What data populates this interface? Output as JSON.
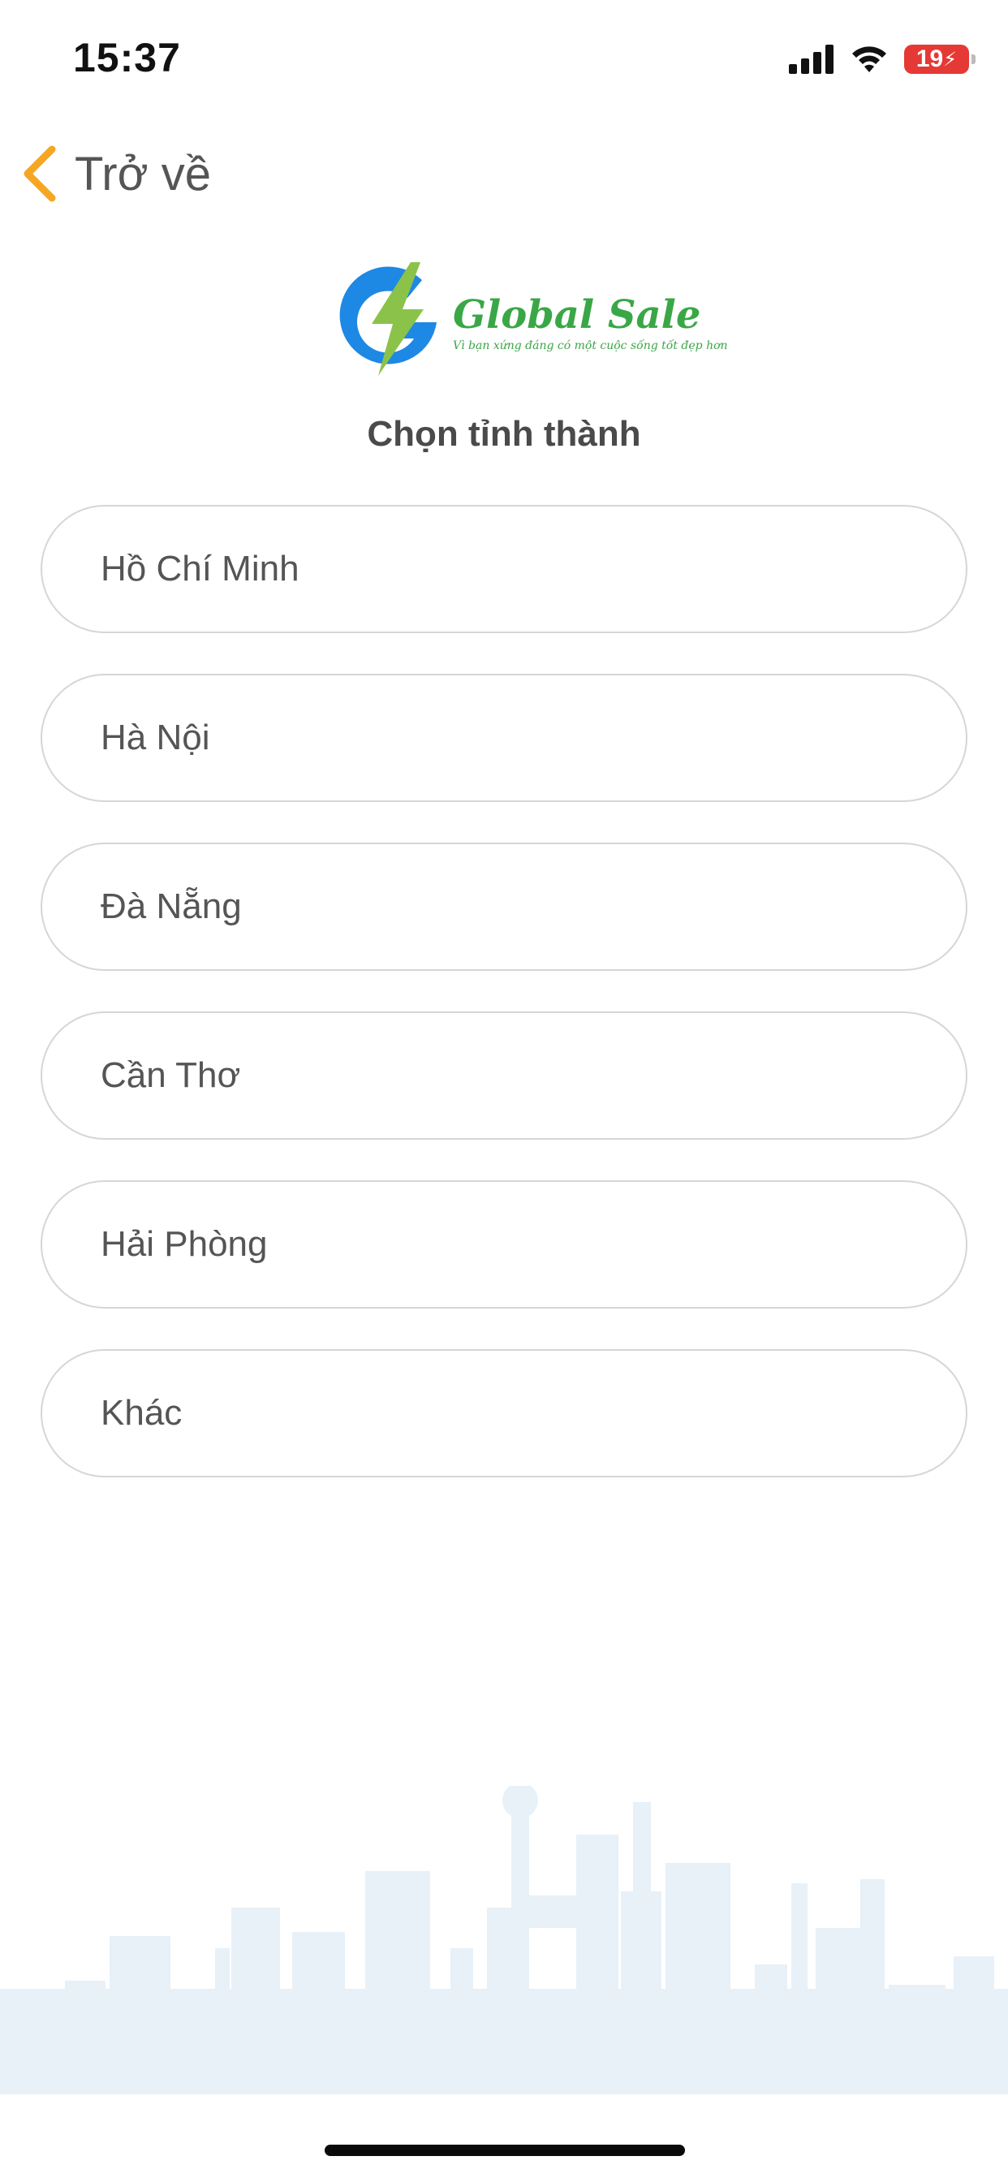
{
  "status_bar": {
    "time": "15:37",
    "battery": "19",
    "icons": [
      "signal-icon",
      "wifi-icon",
      "battery-icon"
    ]
  },
  "nav": {
    "back_label": "Trở về",
    "icon": "chevron-left-icon"
  },
  "logo": {
    "name": "Global Sale",
    "tagline": "Vì bạn xứng đáng có một cuộc sống tốt đẹp hơn"
  },
  "page": {
    "title": "Chọn tỉnh thành"
  },
  "provinces": [
    {
      "label": "Hồ Chí Minh"
    },
    {
      "label": "Hà Nội"
    },
    {
      "label": "Đà Nẵng"
    },
    {
      "label": "Cần Thơ"
    },
    {
      "label": "Hải Phòng"
    },
    {
      "label": "Khác"
    }
  ],
  "colors": {
    "accent": "#f5a623",
    "brand_green": "#3aa746",
    "brand_blue": "#1e88e5",
    "border": "#d6d6d6",
    "skyline": "#e8f1f8"
  }
}
